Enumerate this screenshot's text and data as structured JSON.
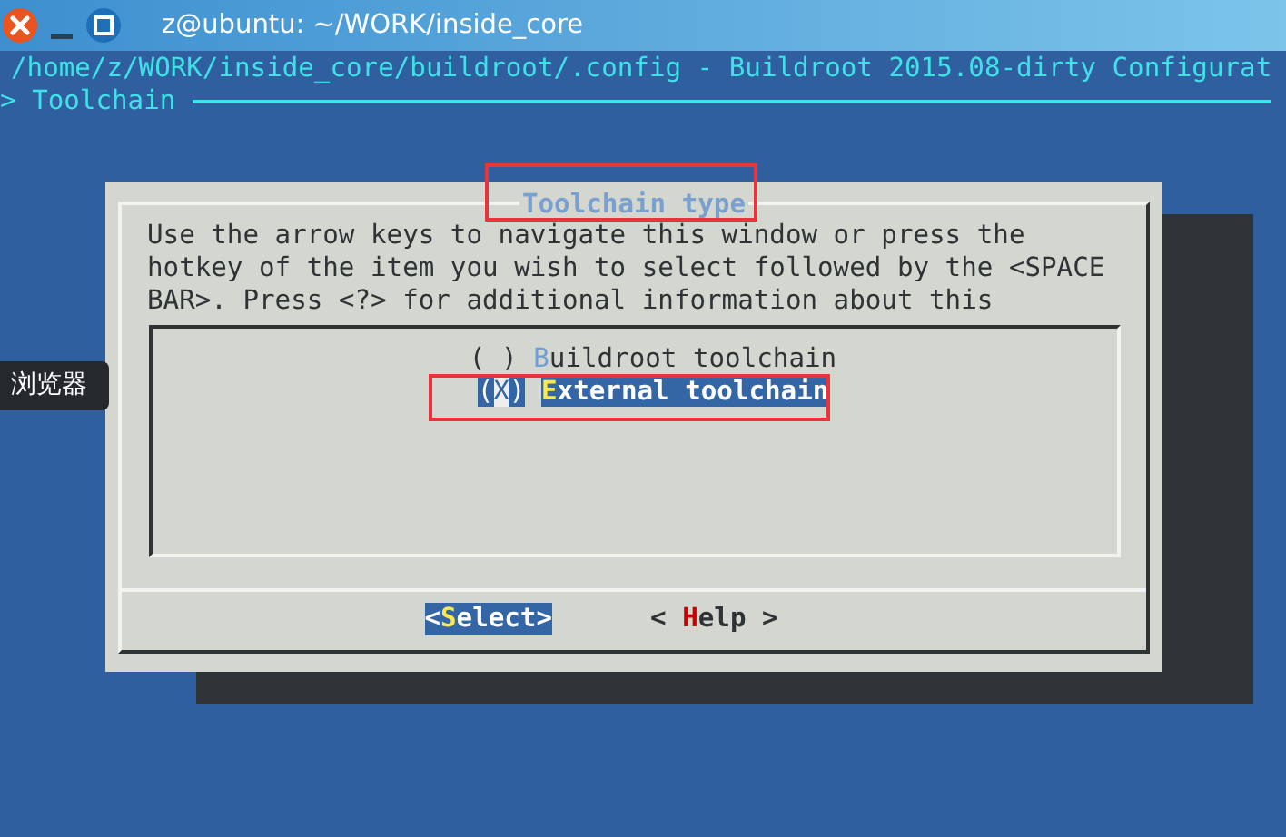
{
  "window": {
    "title": "z@ubuntu: ~/WORK/inside_core"
  },
  "terminal": {
    "header": "/home/z/WORK/inside_core/buildroot/.config - Buildroot 2015.08-dirty Configurat",
    "breadcrumb": "> Toolchain"
  },
  "dialog": {
    "title": "Toolchain type",
    "help_lines": [
      "Use the arrow keys to navigate this window or press the",
      "hotkey of the item you wish to select followed by the <SPACE",
      "BAR>. Press <?> for additional information about this"
    ],
    "options": [
      {
        "marker": "( )",
        "hotkey": "B",
        "rest": "uildroot toolchain",
        "selected": false
      },
      {
        "marker": "(X)",
        "hotkey": "E",
        "rest": "xternal toolchain",
        "selected": true
      }
    ],
    "buttons": [
      {
        "open": "<",
        "hotkey": "S",
        "rest": "elect",
        "close": ">",
        "selected": true
      },
      {
        "open": "< ",
        "hotkey": "H",
        "rest": "elp",
        "close": " >",
        "selected": false
      }
    ]
  },
  "tooltip": {
    "text": "浏览器"
  }
}
